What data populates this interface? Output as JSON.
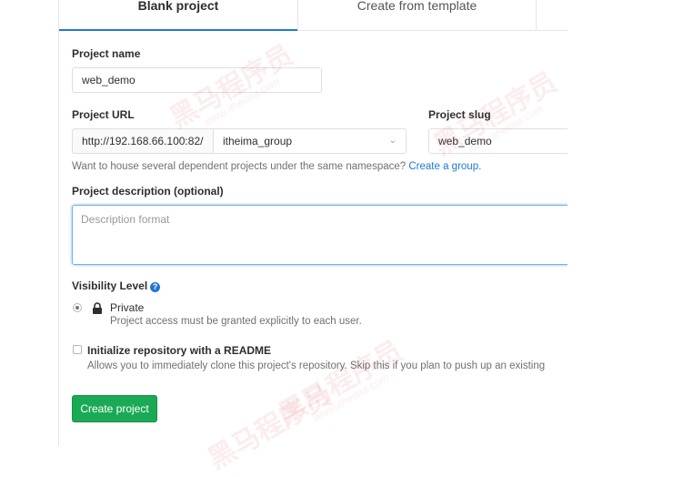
{
  "tabs": {
    "active": "Blank project",
    "inactive": "Create from template"
  },
  "project_name": {
    "label": "Project name",
    "value": "web_demo"
  },
  "project_url": {
    "label": "Project URL",
    "prefix": "http://192.168.66.100:82/",
    "namespace": "itheima_group"
  },
  "project_slug": {
    "label": "Project slug",
    "value": "web_demo"
  },
  "namespace_help": {
    "text": "Want to house several dependent projects under the same namespace?",
    "link": "Create a group."
  },
  "description": {
    "label": "Project description (optional)",
    "placeholder": "Description format"
  },
  "visibility": {
    "label": "Visibility Level",
    "option_label": "Private",
    "option_help": "Project access must be granted explicitly to each user."
  },
  "readme": {
    "label": "Initialize repository with a README",
    "help": "Allows you to immediately clone this project's repository. Skip this if you plan to push up an existing"
  },
  "actions": {
    "create": "Create project"
  },
  "watermark": {
    "chinese": "黑马程序员",
    "url": "www.itheima.com"
  },
  "colors": {
    "accent": "#1f78d1",
    "create_button": "#1aaa55"
  }
}
